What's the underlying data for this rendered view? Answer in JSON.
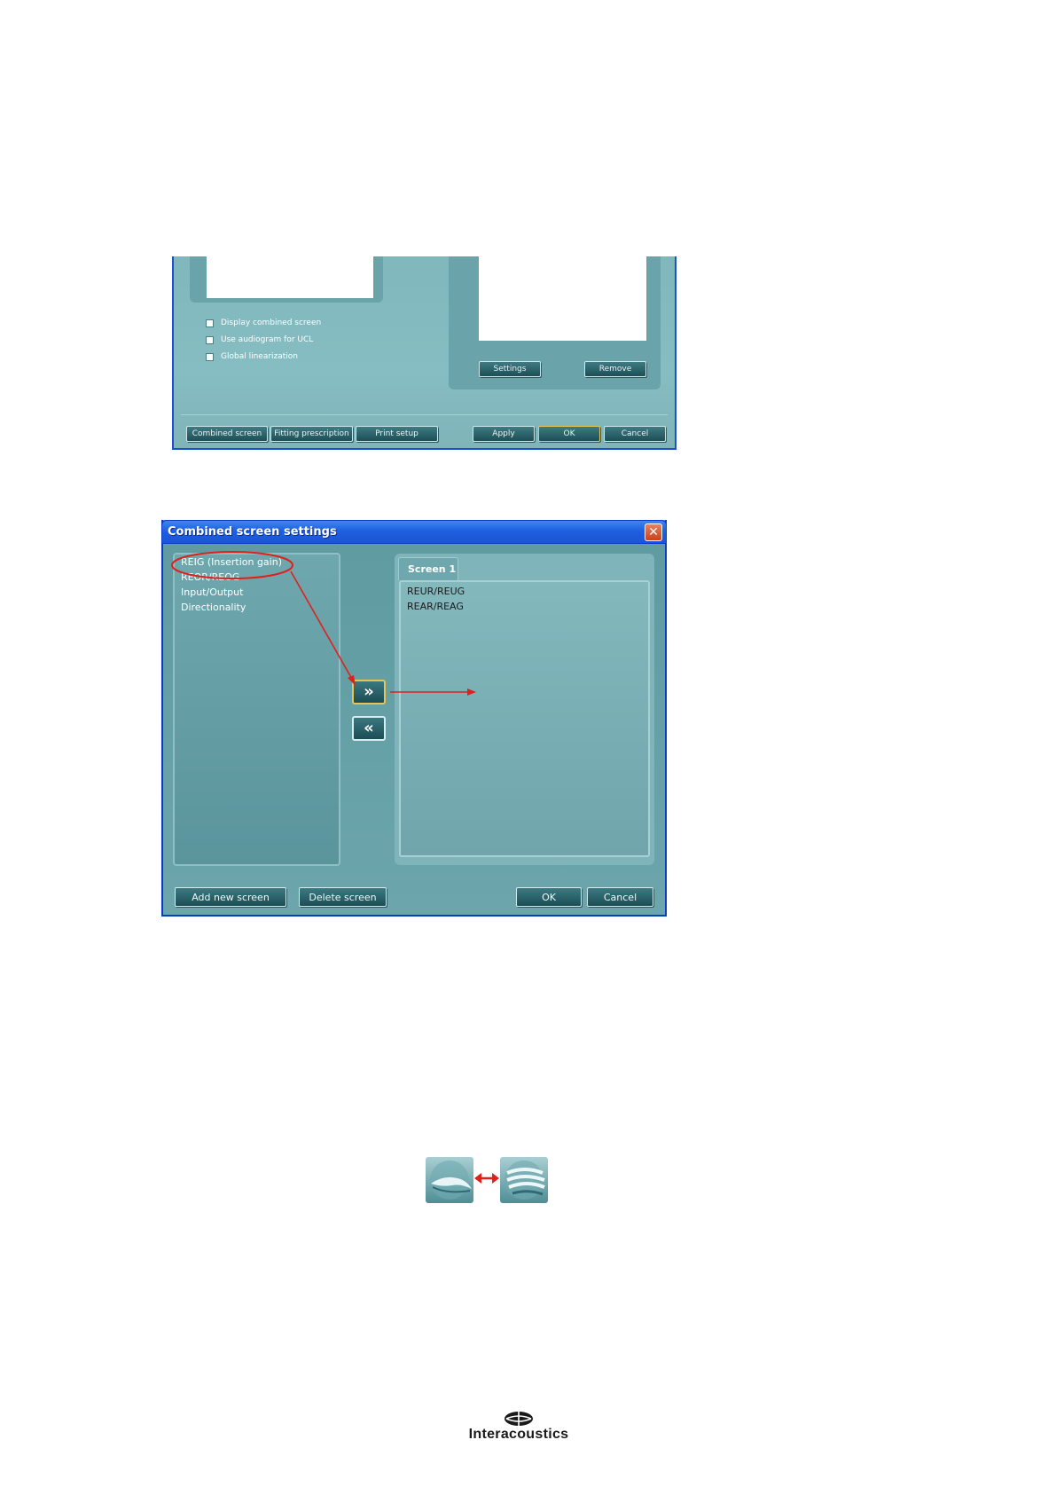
{
  "settings_window": {
    "checkboxes": [
      {
        "label": "Display combined screen",
        "checked": false
      },
      {
        "label": "Use audiogram for UCL",
        "checked": false
      },
      {
        "label": "Global linearization",
        "checked": false
      }
    ],
    "buttons": {
      "settings": "Settings",
      "remove": "Remove",
      "combined_screen": "Combined screen",
      "fitting_prescription": "Fitting prescription",
      "print_setup": "Print setup",
      "apply": "Apply",
      "ok": "OK",
      "cancel": "Cancel"
    }
  },
  "combined_dialog": {
    "title": "Combined screen settings",
    "close_glyph": "✕",
    "available_items": [
      "REIG (Insertion gain)",
      "REOR/REOG",
      "Input/Output",
      "Directionality"
    ],
    "tab_label": "Screen 1",
    "screen_items": [
      "REUR/REUG",
      "REAR/REAG"
    ],
    "add_glyph": "»",
    "remove_glyph": "«",
    "buttons": {
      "add_new_screen": "Add new screen",
      "delete_screen": "Delete screen",
      "ok": "OK",
      "cancel": "Cancel"
    }
  },
  "annotation_color": "#e0201b",
  "icons": {
    "left": "ear-probe-icon",
    "right": "hearing-aid-icon",
    "between": "double-arrow-icon"
  },
  "logo": {
    "text": "Interacoustics",
    "icon": "interacoustics-logo-icon"
  }
}
